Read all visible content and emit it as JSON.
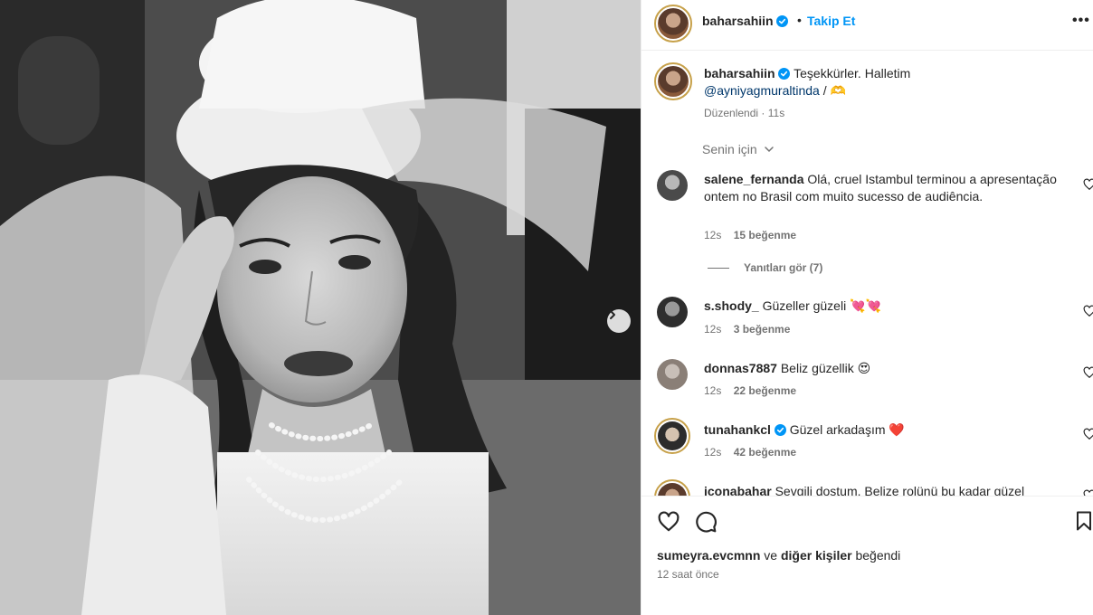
{
  "post": {
    "username": "baharsahiin",
    "verified": true,
    "follow_label": "Takip Et",
    "separator": "•",
    "more_label": "•••",
    "caption": {
      "text": "Teşekkürler. Halletim",
      "mention": "@ayniyagmuraltinda",
      "suffix": "/ 🫶",
      "edited_label": "Düzenlendi",
      "time": "11s"
    },
    "sort_label": "Senin için"
  },
  "comments": [
    {
      "username": "salene_fernanda",
      "verified": false,
      "text": "Olá, cruel Istambul terminou a apresentação ontem no Brasil com muito sucesso de audiência.",
      "time": "12s",
      "likes": "15 beğenme",
      "replies_label": "Yanıtları gör (7)"
    },
    {
      "username": "s.shody_",
      "verified": false,
      "text": "Güzeller güzeli 💘💘",
      "time": "12s",
      "likes": "3 beğenme"
    },
    {
      "username": "donnas7887",
      "verified": false,
      "text": "Beliz güzellik 😍",
      "time": "12s",
      "likes": "22 beğenme"
    },
    {
      "username": "tunahankcl",
      "verified": true,
      "text": "Güzel arkadaşım ❤️",
      "time": "12s",
      "likes": "42 beğenme"
    },
    {
      "username": "iconabahar",
      "verified": false,
      "text": "Sevgili dostum. Belize rolünü bu kadar güzel"
    }
  ],
  "footer": {
    "liked_by_user": "sumeyra.evcmnn",
    "liked_by_connector": "ve",
    "liked_by_others": "diğer kişiler",
    "liked_by_suffix": "beğendi",
    "time_ago": "12 saat önce"
  },
  "icons": {
    "like": "heart-icon",
    "comment": "comment-icon",
    "save": "bookmark-icon",
    "verified": "verified-badge-icon",
    "next": "chevron-right-icon",
    "sort": "chevron-down-icon"
  },
  "colors": {
    "link_blue": "#0095f6",
    "mention_blue": "#00376b",
    "verified_blue": "#0095f6",
    "secondary_text": "#737373",
    "border": "#efefef"
  }
}
